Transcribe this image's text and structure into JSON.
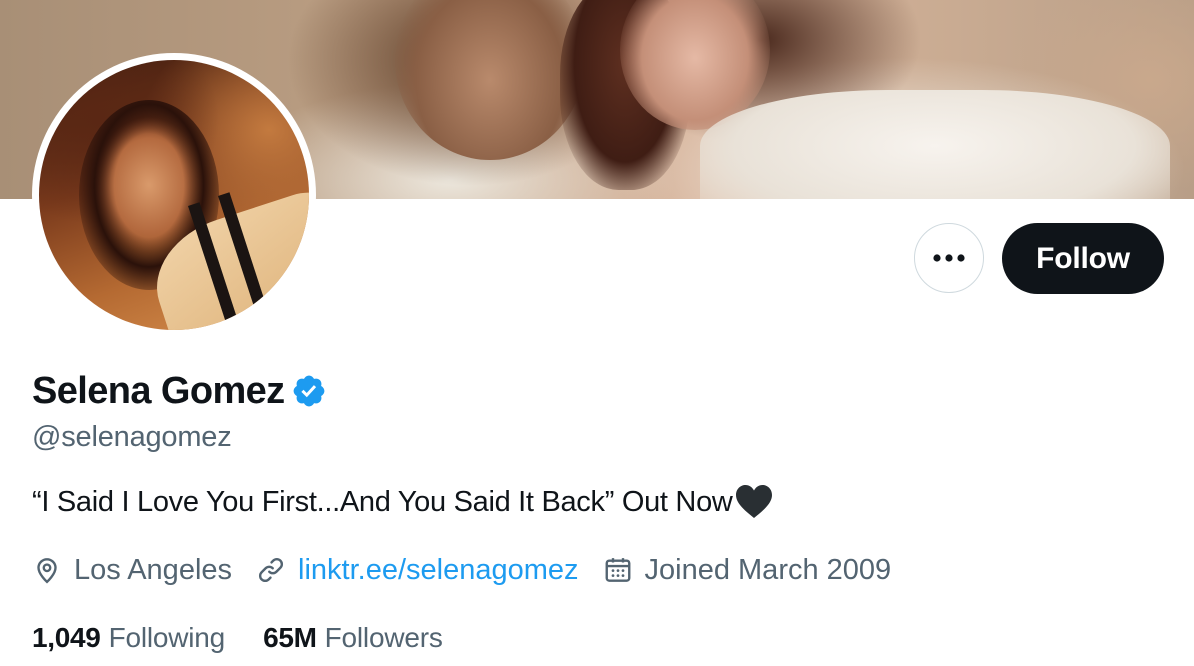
{
  "profile": {
    "display_name": "Selena Gomez",
    "handle": "@selenagomez",
    "bio": "“I Said I Love You First...And You Said It Back” Out Now",
    "location": "Los Angeles",
    "website": "linktr.ee/selenagomez",
    "joined": "Joined March 2009",
    "verified": true
  },
  "actions": {
    "follow_label": "Follow",
    "more_icon": "more-horizontal-icon"
  },
  "stats": {
    "following_count": "1,049",
    "following_label": "Following",
    "followers_count": "65M",
    "followers_label": "Followers"
  },
  "icons": {
    "verified": "verified-badge-icon",
    "heart": "black-heart-icon",
    "location": "location-pin-icon",
    "link": "link-icon",
    "calendar": "calendar-icon"
  },
  "colors": {
    "accent": "#1d9bf0",
    "text_primary": "#0f1419",
    "text_secondary": "#536471",
    "follow_bg": "#0f1419",
    "border": "#cfd9de"
  }
}
